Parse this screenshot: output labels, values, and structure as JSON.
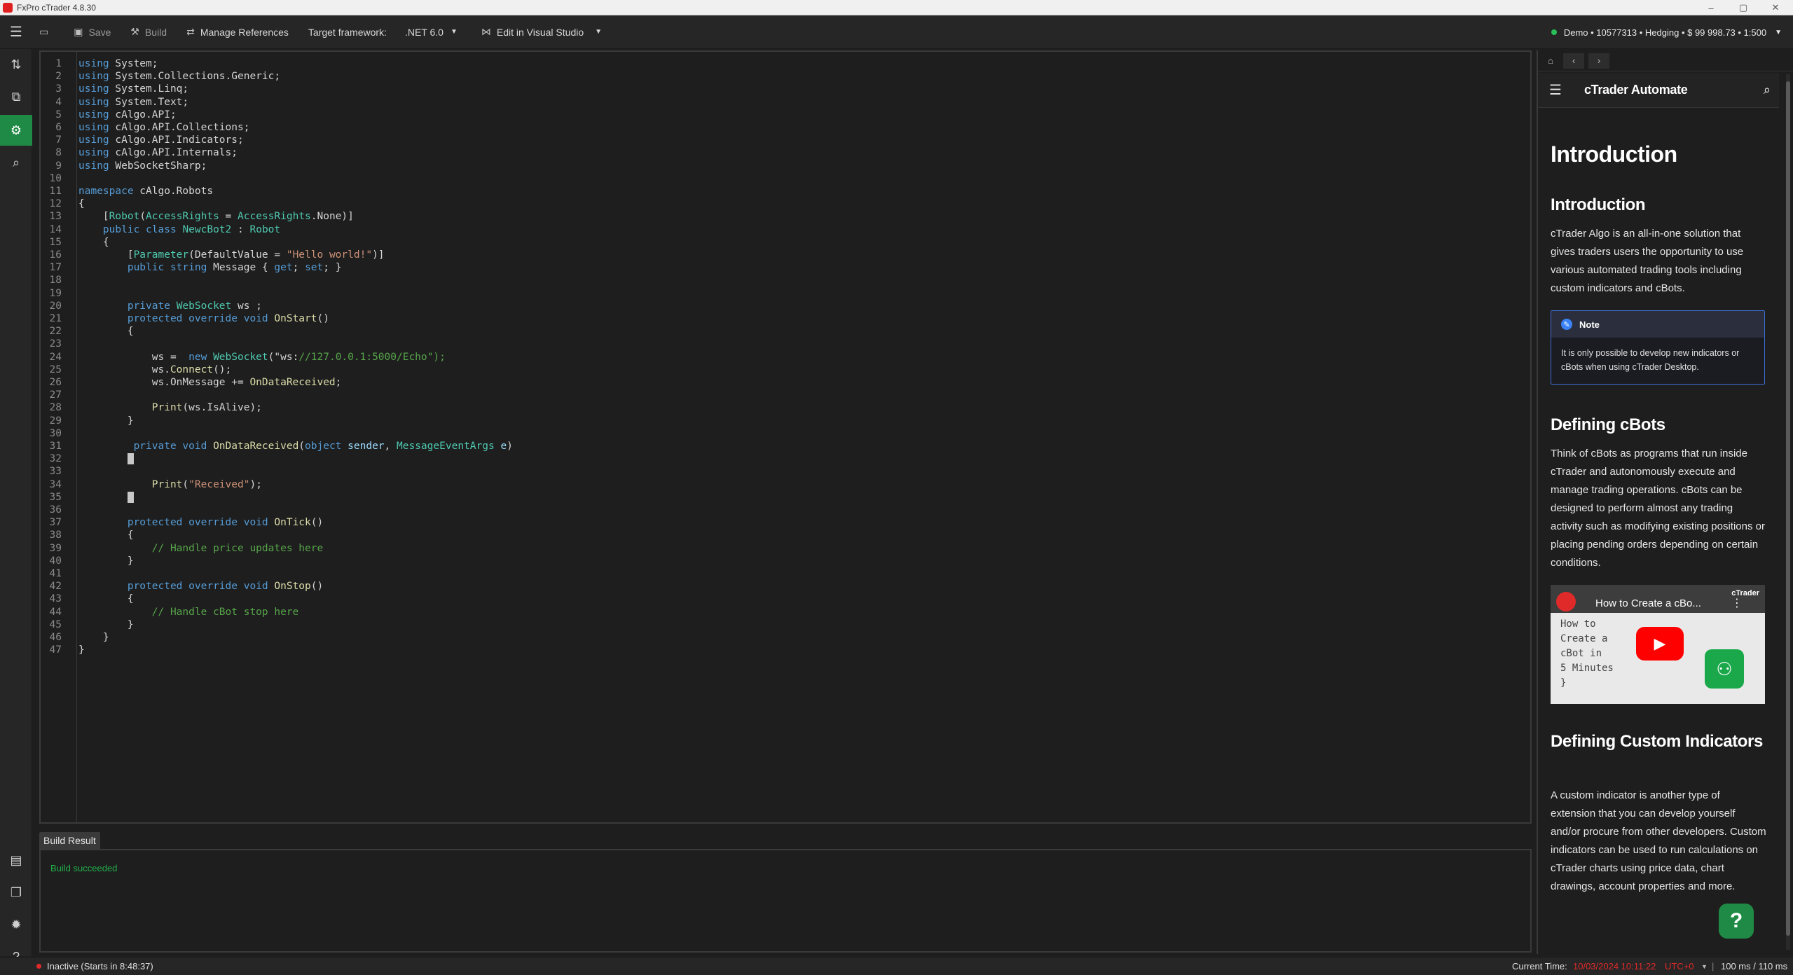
{
  "window": {
    "title": "FxPro cTrader 4.8.30",
    "controls": [
      "–",
      "▢",
      "✕"
    ]
  },
  "toolbar": {
    "save_label": "Save",
    "build_label": "Build",
    "manage_refs_label": "Manage References",
    "target_framework_label": "Target framework:",
    "target_framework_value": ".NET 6.0",
    "edit_vs_label": "Edit in Visual Studio",
    "account_text": "Demo • 10577313 • Hedging • $ 99 998.73 • 1:500"
  },
  "left_sidebar": {
    "items": [
      {
        "icon": "menu-icon"
      },
      {
        "icon": "trade-icon"
      },
      {
        "icon": "copy-icon"
      },
      {
        "icon": "automate-icon",
        "active": true
      },
      {
        "icon": "analyze-icon"
      },
      {
        "icon": "store-icon"
      },
      {
        "icon": "window-icon"
      },
      {
        "icon": "settings-icon"
      },
      {
        "icon": "help-icon"
      }
    ]
  },
  "editor": {
    "lines": [
      "using System;",
      "using System.Collections.Generic;",
      "using System.Linq;",
      "using System.Text;",
      "using cAlgo.API;",
      "using cAlgo.API.Collections;",
      "using cAlgo.API.Indicators;",
      "using cAlgo.API.Internals;",
      "using WebSocketSharp;",
      "",
      "namespace cAlgo.Robots",
      "{",
      "    [Robot(AccessRights = AccessRights.None)]",
      "    public class NewcBot2 : Robot",
      "    {",
      "        [Parameter(DefaultValue = \"Hello world!\")]",
      "        public string Message { get; set; }",
      "",
      "",
      "        private WebSocket ws ;",
      "        protected override void OnStart()",
      "        {",
      "",
      "            ws =  new WebSocket(\"ws://127.0.0.1:5000/Echo\");",
      "            ws.Connect();",
      "            ws.OnMessage += OnDataReceived;",
      "",
      "            Print(ws.IsAlive);",
      "        }",
      "",
      "         private void OnDataReceived(object sender, MessageEventArgs e)",
      "        ",
      "",
      "            Print(\"Received\");",
      "        ",
      "",
      "        protected override void OnTick()",
      "        {",
      "            // Handle price updates here",
      "        }",
      "",
      "        protected override void OnStop()",
      "        {",
      "            // Handle cBot stop here",
      "        }",
      "    }",
      "}"
    ]
  },
  "bottom_panel": {
    "tab_label": "Build Result",
    "message": "Build succeeded"
  },
  "status_bar": {
    "bot_status": "Inactive (Starts in 8:48:37)",
    "current_time_label": "Current Time:",
    "current_time_value": "10/03/2024 10:11:22",
    "timezone": "UTC+0",
    "latency": "100 ms / 110 ms"
  },
  "help_panel": {
    "header_title": "cTrader Automate",
    "page_title": "Introduction",
    "section1_title": "Introduction",
    "section1_text": "cTrader Algo is an all-in-one solution that gives traders users the opportunity to use various automated trading tools including custom indicators and cBots.",
    "note_title": "Note",
    "note_text": "It is only possible to develop new indicators or cBots when using cTrader Desktop.",
    "section2_title": "Defining cBots",
    "section2_text": "Think of cBots as programs that run inside cTrader and autonomously execute and manage trading operations. cBots can be designed to perform almost any trading activity such as modifying existing positions or placing pending orders depending on certain conditions.",
    "video_title": "How to Create a cBo...",
    "video_code": "How to\nCreate a\ncBot in\n5 Minutes\n}",
    "video_brand": "cTrader",
    "section3_title": "Defining Custom Indicators",
    "section3_text": "A custom indicator is another type of extension that you can develop yourself and/or procure from other developers. Custom indicators can be used to run calculations on cTrader charts using price data, chart drawings, account properties and more.",
    "help_button": "?"
  },
  "colors": {
    "accent_green": "#1f8a45",
    "build_success": "#22b04b",
    "time_red": "#e02a2a",
    "note_border": "#3b6fd4"
  }
}
